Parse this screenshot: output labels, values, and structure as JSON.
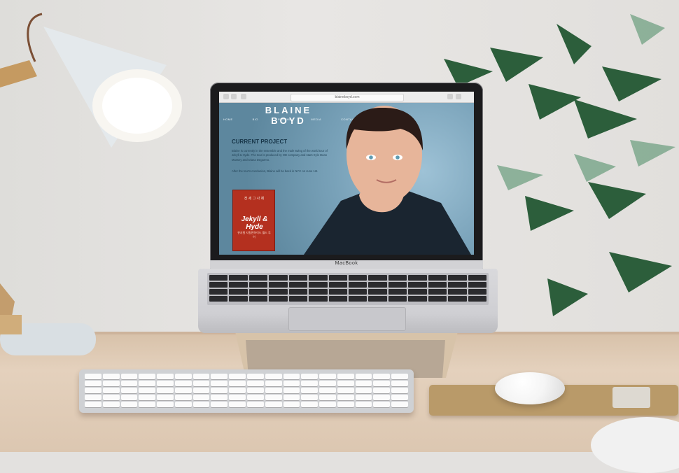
{
  "site": {
    "brand": "BLAINE BOYD",
    "nav": [
      "HOME",
      "BIO",
      "RESUME",
      "MEDIA",
      "CONTACT"
    ],
    "section_title": "CURRENT PROJECT",
    "paragraph1": "Blaine is currently in the ensemble and the male swing of the world tour of Jekyll & Hyde. The tour is produced by OD company and stars Kyle Dean Massey and Diana Degarmo.",
    "paragraph2": "After the tour's conclusion, Blaine will be back in NYC on June 1st.",
    "url": "blaineboyd.com",
    "poster": {
      "top_text": "전 세 그 사 제",
      "title": "Jekyll & Hyde",
      "subtitle": "뮤지컬 지킬앤하이드 월드 투어"
    }
  },
  "device": {
    "label": "MacBook"
  },
  "colors": {
    "site_background": "#6d98b0",
    "poster": "#b4301f",
    "laptop_frame": "#1b1b1d",
    "desk": "#dcc7b1",
    "mousepad": "#b99a69"
  }
}
